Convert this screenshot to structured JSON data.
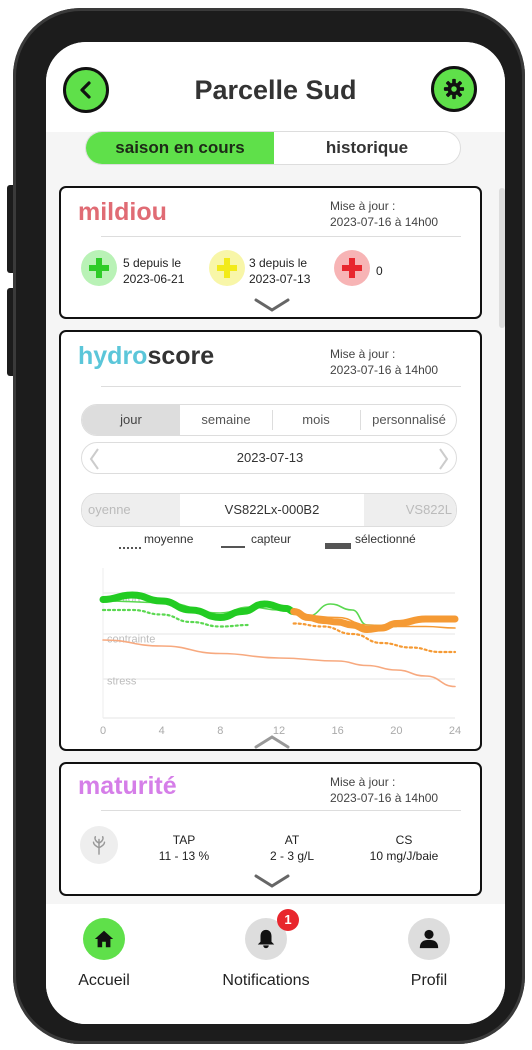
{
  "header": {
    "title": "Parcelle Sud"
  },
  "toggle": {
    "active": "saison en cours",
    "inactive": "historique"
  },
  "mildiou": {
    "title": "mildiou",
    "update_label": "Mise à jour :",
    "update_date": "2023-07-16 à 14h00",
    "status": [
      {
        "color": "#2ecc28",
        "line1": "5 depuis le",
        "line2": "2023-06-21"
      },
      {
        "color": "#f2ea1a",
        "line1": "3 depuis le",
        "line2": "2023-07-13"
      },
      {
        "color": "#e8262d",
        "line1": "0",
        "line2": ""
      }
    ]
  },
  "hydroscore": {
    "title_part1": "hydro",
    "title_part2": "score",
    "update_label": "Mise à jour :",
    "update_date": "2023-07-16 à 14h00",
    "periods": [
      "jour",
      "semaine",
      "mois",
      "personnalisé"
    ],
    "selected_period": "jour",
    "date": "2023-07-13",
    "sensors": [
      "oyenne",
      "VS822Lx-000B2",
      "VS822L"
    ],
    "legend": {
      "mean": "moyenne",
      "sensor": "capteur",
      "selected": "sélectionné"
    }
  },
  "chart_data": {
    "type": "line",
    "x_ticks": [
      "0",
      "4",
      "8",
      "12",
      "16",
      "20",
      "24"
    ],
    "xlim": [
      0,
      24
    ],
    "ylim": [
      0,
      10
    ],
    "zones": [
      "confort",
      "contrainte",
      "stress"
    ],
    "series": [
      {
        "style": "green-selected",
        "color": "#22cc22",
        "x": [
          0,
          2,
          4,
          6,
          8,
          9.5,
          11,
          12.5,
          13
        ],
        "y": [
          7.9,
          8.2,
          7.8,
          7.2,
          6.7,
          7.1,
          7.6,
          7.3,
          7.1
        ]
      },
      {
        "style": "green-sensor",
        "color": "#5ad850",
        "x": [
          0,
          4,
          8,
          10,
          12,
          14,
          15.5,
          17,
          18,
          20
        ],
        "y": [
          7.8,
          7.7,
          7.0,
          7.4,
          7.2,
          6.8,
          7.6,
          7.2,
          6.2,
          6.1
        ]
      },
      {
        "style": "green-mean",
        "color": "#5ad850",
        "x": [
          0,
          2,
          4,
          6,
          8,
          10
        ],
        "y": [
          7.2,
          7.2,
          6.9,
          6.4,
          6.1,
          6.2
        ]
      },
      {
        "style": "orange-selected",
        "color": "#f59a34",
        "x": [
          13,
          14,
          15,
          16,
          17,
          18,
          19,
          20,
          22,
          24
        ],
        "y": [
          7.1,
          6.7,
          6.5,
          6.4,
          6.2,
          5.9,
          6.0,
          6.3,
          6.6,
          6.6
        ]
      },
      {
        "style": "orange-sensor",
        "color": "#f59a34",
        "x": [
          13,
          16,
          18,
          20,
          22,
          24
        ],
        "y": [
          6.9,
          6.7,
          6.2,
          6.1,
          6.1,
          6.0
        ]
      },
      {
        "style": "orange-mean",
        "color": "#f59a34",
        "x": [
          13,
          15,
          17,
          19,
          21,
          23,
          24
        ],
        "y": [
          6.3,
          6.1,
          5.6,
          5.0,
          4.7,
          4.4,
          4.4
        ]
      },
      {
        "style": "salmon-sensor",
        "color": "#f7a97f",
        "x": [
          0,
          4,
          8,
          12,
          16,
          18,
          20,
          22,
          24
        ],
        "y": [
          5.2,
          4.8,
          4.3,
          4.0,
          3.8,
          3.5,
          3.2,
          2.8,
          2.1
        ]
      }
    ]
  },
  "maturite": {
    "title": "maturité",
    "update_label": "Mise à jour :",
    "update_date": "2023-07-16 à 14h00",
    "metrics": [
      {
        "label": "TAP",
        "value": "11 - 13 %"
      },
      {
        "label": "AT",
        "value": "2 - 3 g/L"
      },
      {
        "label": "CS",
        "value": "10 mg/J/baie"
      }
    ]
  },
  "nav": {
    "home": "Accueil",
    "notifications": "Notifications",
    "notifications_count": "1",
    "profile": "Profil"
  },
  "colors": {
    "accent": "#5fe04a",
    "mildiou": "#e06b74",
    "hydro": "#5bc6d9",
    "maturite": "#d57ee8"
  }
}
